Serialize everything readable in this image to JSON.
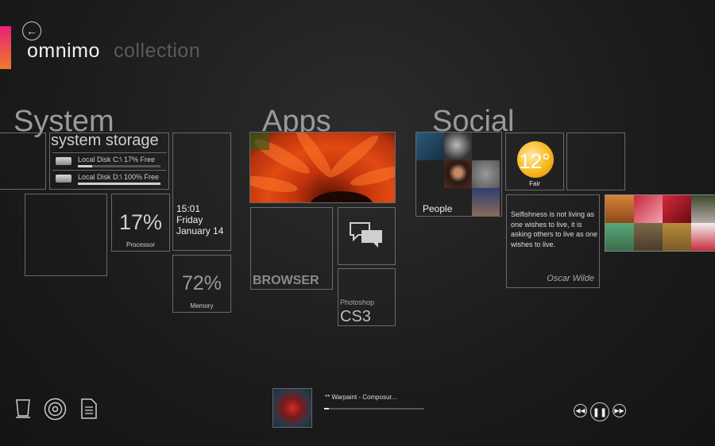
{
  "header": {
    "title": "omnimo",
    "subtitle": "collection",
    "back_icon": "←"
  },
  "sections": {
    "system": "System",
    "apps": "Apps",
    "social": "Social"
  },
  "storage": {
    "title": "system storage",
    "disks": [
      {
        "label": "Local Disk C:\\ 17% Free",
        "free": 0.17
      },
      {
        "label": "Local Disk D:\\ 100% Free",
        "free": 1.0
      }
    ]
  },
  "clock": {
    "time": "15:01",
    "day": "Friday",
    "date": "January 14"
  },
  "processor": {
    "value": "17%",
    "label": "Processor"
  },
  "memory": {
    "value": "72%",
    "label": "Memory"
  },
  "apps": {
    "browser": "BROWSER",
    "photoshop_label": "Photoshop",
    "photoshop_version": "CS3"
  },
  "people": {
    "label": "People"
  },
  "weather": {
    "temp": "12°",
    "condition": "Fair"
  },
  "quote": {
    "text": "Selfishness is not living as one wishes to live, it is asking others to live as one wishes to live.",
    "author": "Oscar Wilde"
  },
  "player": {
    "track": "** Warpaint - Composur...",
    "progress": 0.05
  },
  "colors": {
    "accent_top": "#e8207a",
    "accent_bottom": "#f07a2a",
    "border": "#6a6a6a"
  }
}
